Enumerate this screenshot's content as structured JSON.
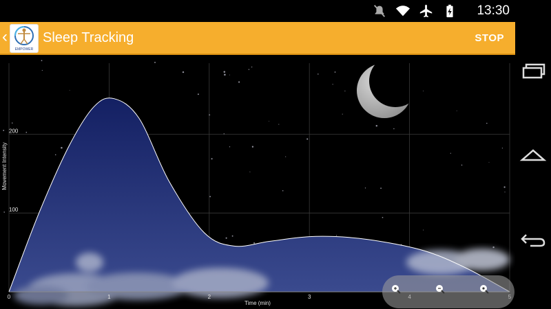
{
  "status_bar": {
    "time": "13:30",
    "icons": [
      "mute-icon",
      "wifi-icon",
      "airplane-icon",
      "battery-icon"
    ]
  },
  "action_bar": {
    "back_icon": "chevron-left-icon",
    "logo_text": "EMPOWER",
    "title": "Sleep Tracking",
    "stop_label": "STOP",
    "background": "#f6ae2d"
  },
  "nav_bar": {
    "buttons": [
      "recent-apps-icon",
      "home-icon",
      "back-icon"
    ]
  },
  "zoom_controls": [
    "zoom-in-icon",
    "zoom-out-icon",
    "zoom-reset-icon"
  ],
  "chart_data": {
    "type": "area",
    "xlabel": "Time (min)",
    "ylabel": "Movement Intensity",
    "xlim": [
      0,
      5
    ],
    "ylim": [
      0,
      290
    ],
    "x_ticks": [
      "0",
      "1",
      "2",
      "3",
      "4",
      "5"
    ],
    "y_ticks": [
      "100",
      "200"
    ],
    "grid": true,
    "series": [
      {
        "x": [
          0,
          0.3,
          0.6,
          0.85,
          1.05,
          1.3,
          1.6,
          1.95,
          2.25,
          2.6,
          3.0,
          3.4,
          3.8,
          4.2,
          4.6,
          5.0
        ],
        "y": [
          0,
          100,
          185,
          235,
          245,
          220,
          140,
          75,
          58,
          64,
          70,
          69,
          62,
          50,
          28,
          0
        ]
      }
    ],
    "colors": {
      "fill": "#1c2a6e",
      "line": "#ffffff",
      "grid": "#3a3a3a"
    }
  }
}
